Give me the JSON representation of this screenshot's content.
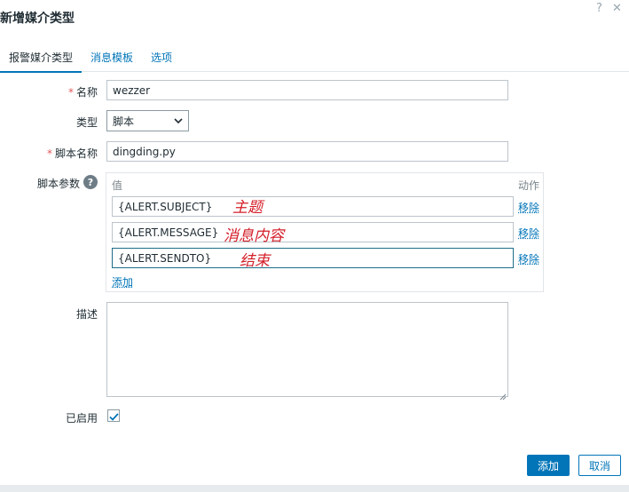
{
  "dialog": {
    "title": "新增媒介类型"
  },
  "window": {
    "help_glyph": "?",
    "close_glyph": "✕"
  },
  "tabs": [
    {
      "label": "报警媒介类型",
      "active": true
    },
    {
      "label": "消息模板",
      "active": false
    },
    {
      "label": "选项",
      "active": false
    }
  ],
  "form": {
    "name_label": "名称",
    "name_value": "wezzer",
    "type_label": "类型",
    "type_value": "脚本",
    "script_name_label": "脚本名称",
    "script_name_value": "dingding.py",
    "params_label": "脚本参数",
    "params_value_header": "值",
    "params_action_header": "动作",
    "params": [
      {
        "value": "{ALERT.SUBJECT}",
        "note": "主题",
        "remove_label": "移除"
      },
      {
        "value": "{ALERT.MESSAGE}",
        "note": "消息内容",
        "remove_label": "移除"
      },
      {
        "value": "{ALERT.SENDTO}",
        "note": "结束",
        "remove_label": "移除"
      }
    ],
    "add_param_label": "添加",
    "description_label": "描述",
    "description_value": "",
    "enabled_label": "已启用",
    "enabled": true
  },
  "footer": {
    "add_label": "添加",
    "cancel_label": "取消"
  },
  "colors": {
    "accent": "#0275b8",
    "required": "#e45959",
    "annotation": "#d4202a"
  }
}
